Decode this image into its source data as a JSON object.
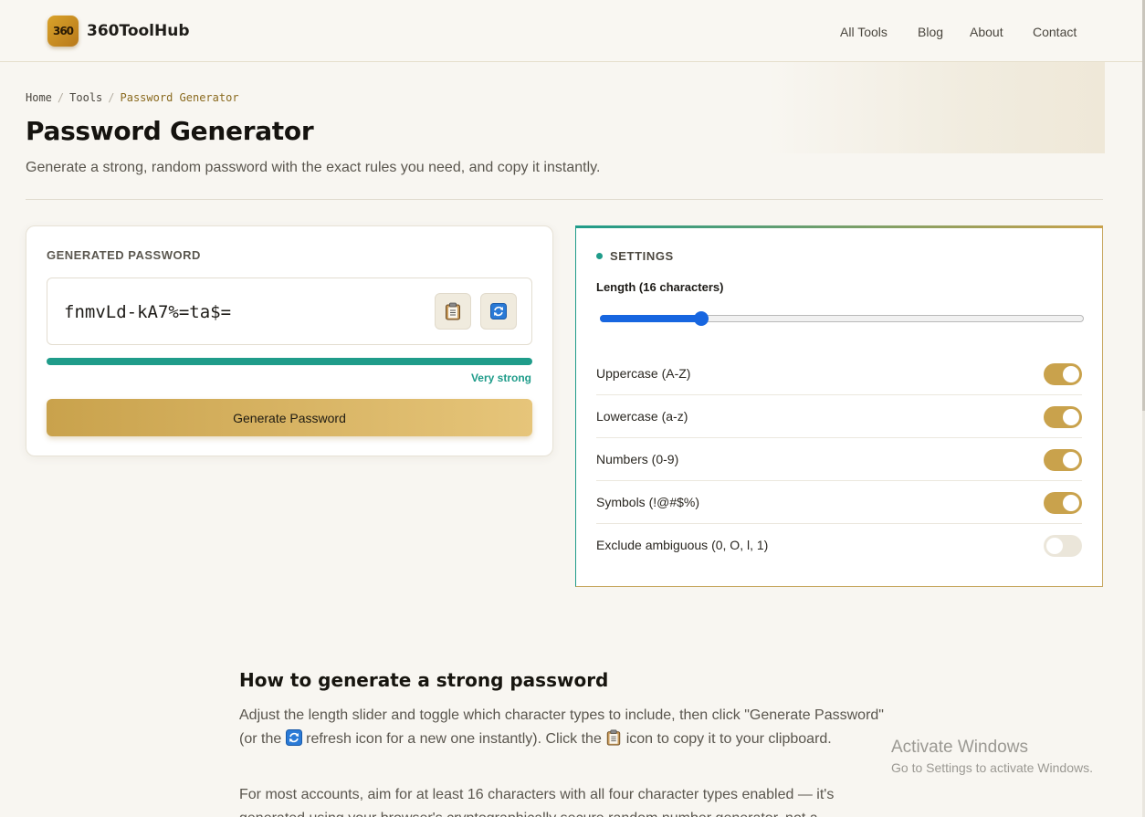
{
  "header": {
    "logo_text": "360",
    "brand": "360ToolHub",
    "nav": [
      "All Tools",
      "Blog",
      "About",
      "Contact"
    ]
  },
  "breadcrumb": [
    "Home",
    "Tools",
    "Password Generator"
  ],
  "page": {
    "title": "Password Generator",
    "subtitle": "Generate a strong, random password with the exact rules you need, and copy it instantly."
  },
  "generator": {
    "label": "GENERATED PASSWORD",
    "password": "fnmvLd-kA7%=ta$=",
    "copy_icon": "clipboard-icon",
    "refresh_icon": "refresh-icon",
    "strength": "Very strong",
    "strength_level": 1.0,
    "button": "Generate Password"
  },
  "settings": {
    "label": "SETTINGS",
    "length_label": "Length (16 characters)",
    "length_value": 16,
    "length_min": 4,
    "length_max": 64,
    "options": [
      {
        "label": "Uppercase (A-Z)",
        "enabled": true
      },
      {
        "label": "Lowercase (a-z)",
        "enabled": true
      },
      {
        "label": "Numbers (0-9)",
        "enabled": true
      },
      {
        "label": "Symbols (!@#$%)",
        "enabled": true
      },
      {
        "label": "Exclude ambiguous (0, O, l, 1)",
        "enabled": false
      }
    ]
  },
  "article": {
    "heading": "How to generate a strong password",
    "p1_a": "Adjust the length slider and toggle which character types to include, then click \"Generate Password\" (or the ",
    "p1_b": " refresh icon for a new one instantly). Click the ",
    "p1_c": " icon to copy it to your clipboard.",
    "p2": "For most accounts, aim for at least 16 characters with all four character types enabled — it's generated using your browser's cryptographically secure random number generator, not a"
  },
  "watermark": {
    "title": "Activate Windows",
    "subtitle": "Go to Settings to activate Windows."
  },
  "colors": {
    "background": "#f8f6f1",
    "accent_teal": "#1f9c8a",
    "accent_gold": "#c9a24c",
    "slider_blue": "#1766e0"
  }
}
